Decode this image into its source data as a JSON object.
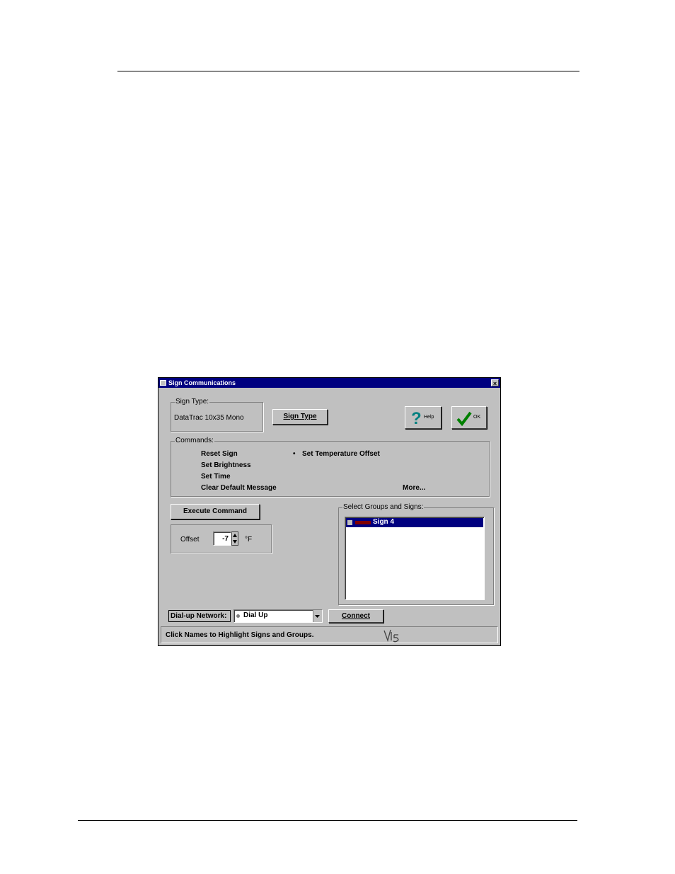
{
  "window": {
    "title": "Sign Communications",
    "close_label": "×"
  },
  "sign_type": {
    "group_label": "Sign Type:",
    "value": "DataTrac 10x35 Mono",
    "button_label": "Sign Type"
  },
  "help": {
    "label": "Help"
  },
  "ok": {
    "label": "OK"
  },
  "commands": {
    "group_label": "Commands:",
    "items": [
      "Reset Sign",
      "Set Brightness",
      "Set Time",
      "Clear Default Message"
    ],
    "selected": "Set Temperature Offset",
    "more": "More..."
  },
  "execute": {
    "label": "Execute Command"
  },
  "offset": {
    "label": "Offset",
    "value": "-7",
    "unit": "°F"
  },
  "groups": {
    "label": "Select Groups and Signs:",
    "items": [
      {
        "name": "Sign 4",
        "selected": true
      }
    ]
  },
  "network": {
    "label": "Dial-up Network:",
    "value": "Dial Up",
    "connect": "Connect"
  },
  "status": {
    "text": "Click Names to Highlight Signs and Groups."
  },
  "colors": {
    "title_bar": "#000080",
    "face": "#c0c0c0",
    "selection": "#000080",
    "help_mark": "#008080",
    "check": "#008000"
  }
}
